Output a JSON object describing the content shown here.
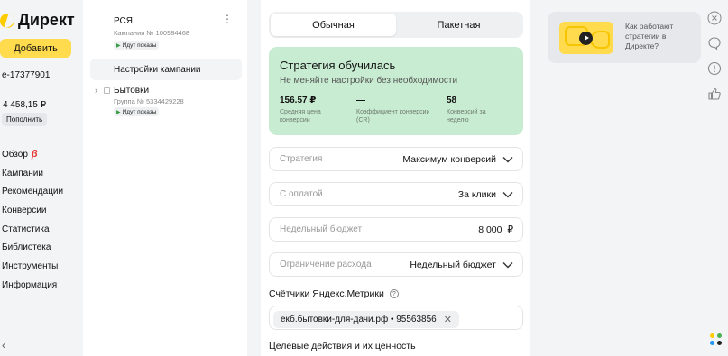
{
  "sidebar": {
    "logo_text": "Директ",
    "add_button": "Добавить",
    "login": "e-17377901",
    "balance": "4 458,15 ₽",
    "topup_button": "Пополнить",
    "beta_mark": "β",
    "nav": [
      "Обзор",
      "Кампании",
      "Рекомендации",
      "Конверсии",
      "Статистика",
      "Библиотека",
      "Инструменты",
      "Информация"
    ],
    "collapse_icon": "‹"
  },
  "tree": {
    "campaign_name": "РСЯ",
    "campaign_meta": "Кампания № 100984468",
    "campaign_status": "Идут показы",
    "more_icon": "⋮",
    "settings_item": "Настройки кампании",
    "group_expand": "›",
    "group_name": "Бытовки",
    "group_meta": "Группа № 5334429228",
    "group_status": "Идут показы"
  },
  "main": {
    "tabs": [
      {
        "label": "Обычная",
        "active": true
      },
      {
        "label": "Пакетная",
        "active": false
      }
    ],
    "hint": {
      "title": "Стратегия обучилась",
      "subtitle": "Не меняйте настройки без необходимости",
      "metrics": [
        {
          "value": "156.57 ₽",
          "label": "Средняя цена конверсии"
        },
        {
          "value": "—",
          "label": "Коэффициент конверсии (CR)"
        },
        {
          "value": "58",
          "label": "Конверсий за неделю"
        }
      ]
    },
    "fields": [
      {
        "label": "Стратегия",
        "value": "Максимум конверсий",
        "has_chevron": true
      },
      {
        "label": "С оплатой",
        "value": "За клики",
        "has_chevron": true
      },
      {
        "label": "Недельный бюджет",
        "value": "8 000  ₽",
        "has_chevron": false
      },
      {
        "label": "Ограничение расхода",
        "value": "Недельный бюджет",
        "has_chevron": true
      }
    ],
    "counters_title": "Счётчики Яндекс.Метрики",
    "help_mark": "?",
    "counter_chip": "екб.бытовки-для-дачи.рф • 95563856",
    "chip_remove": "✕",
    "goals_title": "Целевые действия и их ценность"
  },
  "promo": {
    "text": "Как работают стратегии в Директе?"
  },
  "colors": {
    "accent_yellow": "#ffdb4d",
    "hint_green": "#c8ecd1",
    "beta_red": "#e53935"
  },
  "icons": [
    "close-icon",
    "chat-icon",
    "alert-icon",
    "like-icon",
    "apps-icon"
  ]
}
